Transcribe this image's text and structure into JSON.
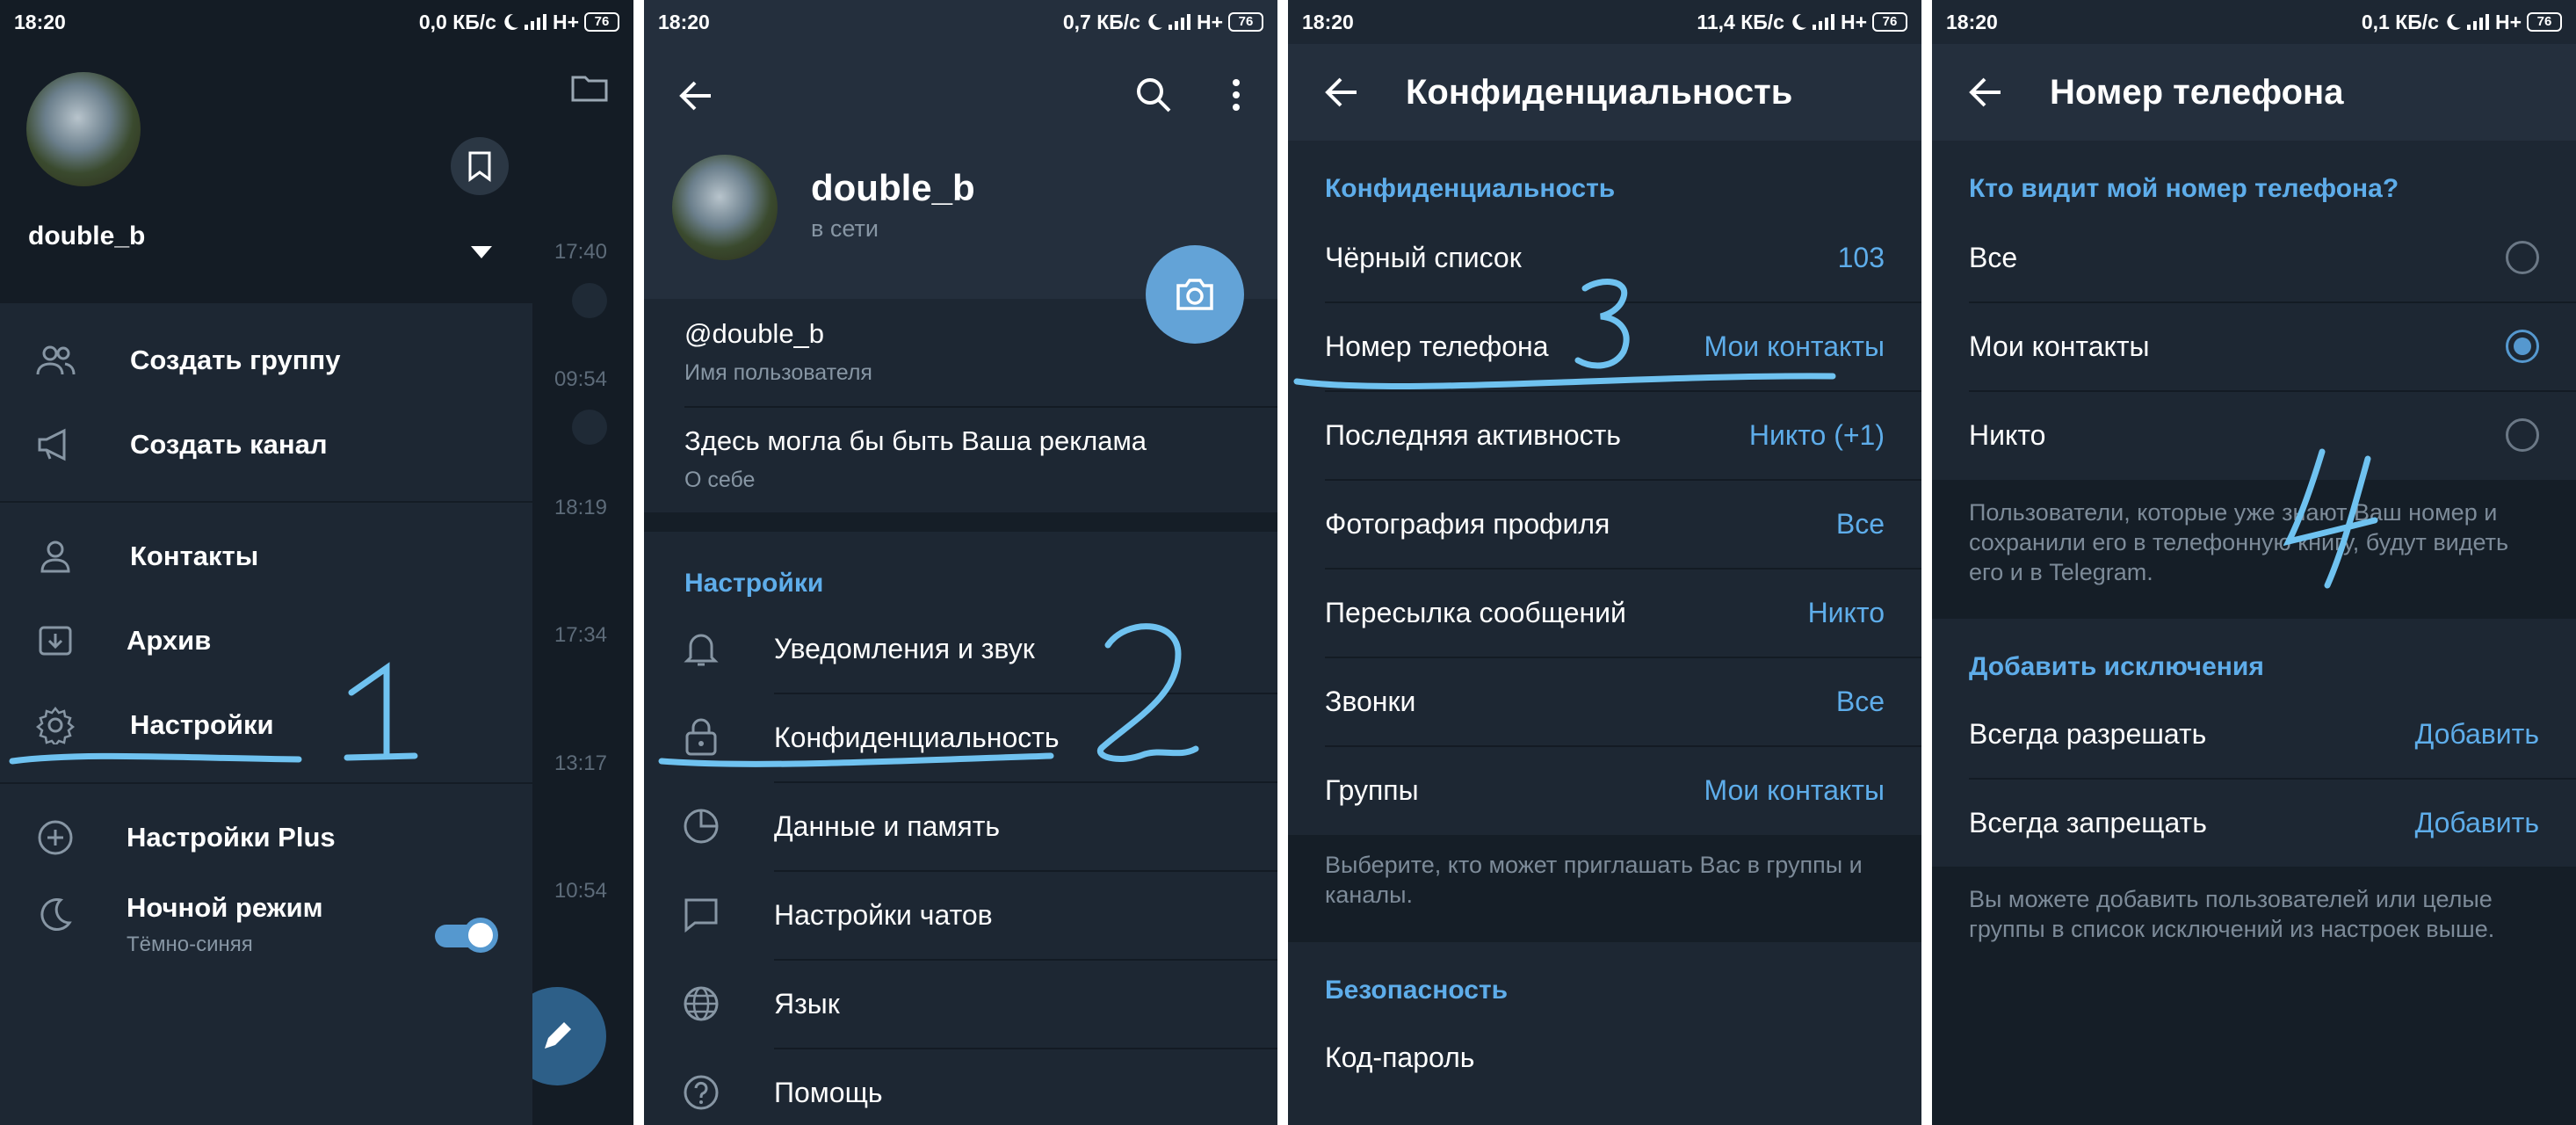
{
  "screens": [
    {
      "status": {
        "time": "18:20",
        "speed": "0,0 КБ/с",
        "network": "H+",
        "battery": "76"
      },
      "drawer": {
        "name": "double_b",
        "menu": [
          {
            "label": "Создать группу",
            "icon": "group-icon"
          },
          {
            "label": "Создать канал",
            "icon": "megaphone-icon"
          },
          {
            "label": "Контакты",
            "icon": "person-icon"
          },
          {
            "label": "Архив",
            "icon": "archive-icon"
          },
          {
            "label": "Настройки",
            "icon": "gear-icon"
          },
          {
            "label": "Настройки Plus",
            "icon": "plus-circle-icon"
          },
          {
            "label": "Ночной режим",
            "sub": "Тёмно-синяя",
            "icon": "moon-icon"
          }
        ],
        "night_mode_enabled": true
      },
      "chat_times": [
        "17:40",
        "09:54",
        "18:19",
        "17:34",
        "13:17",
        "10:54"
      ],
      "annotation": "1"
    },
    {
      "status": {
        "time": "18:20",
        "speed": "0,7 КБ/с",
        "network": "H+",
        "battery": "76"
      },
      "profile": {
        "name": "double_b",
        "status": "в сети"
      },
      "username": {
        "value": "@double_b",
        "label": "Имя пользователя"
      },
      "bio": {
        "value": "Здесь могла бы быть Ваша реклама",
        "label": "О себе"
      },
      "settings_title": "Настройки",
      "settings": [
        {
          "label": "Уведомления и звук",
          "icon": "bell-icon"
        },
        {
          "label": "Конфиденциальность",
          "icon": "lock-icon"
        },
        {
          "label": "Данные и память",
          "icon": "pie-chart-icon"
        },
        {
          "label": "Настройки чатов",
          "icon": "chat-bubble-icon"
        },
        {
          "label": "Язык",
          "icon": "globe-icon"
        },
        {
          "label": "Помощь",
          "icon": "help-icon"
        }
      ],
      "annotation": "2"
    },
    {
      "status": {
        "time": "18:20",
        "speed": "11,4 КБ/с",
        "network": "H+",
        "battery": "76"
      },
      "title": "Конфиденциальность",
      "section1": "Конфиденциальность",
      "rows": [
        {
          "label": "Чёрный список",
          "value": "103"
        },
        {
          "label": "Номер телефона",
          "value": "Мои контакты"
        },
        {
          "label": "Последняя активность",
          "value": "Никто (+1)"
        },
        {
          "label": "Фотография профиля",
          "value": "Все"
        },
        {
          "label": "Пересылка сообщений",
          "value": "Никто"
        },
        {
          "label": "Звонки",
          "value": "Все"
        },
        {
          "label": "Группы",
          "value": "Мои контакты"
        }
      ],
      "groups_hint": "Выберите, кто может приглашать Вас в группы и каналы.",
      "section2": "Безопасность",
      "security_rows": [
        {
          "label": "Код-пароль"
        }
      ],
      "annotation": "3"
    },
    {
      "status": {
        "time": "18:20",
        "speed": "0,1 КБ/с",
        "network": "H+",
        "battery": "76"
      },
      "title": "Номер телефона",
      "question": "Кто видит мой номер телефона?",
      "options": [
        {
          "label": "Все",
          "selected": false
        },
        {
          "label": "Мои контакты",
          "selected": true
        },
        {
          "label": "Никто",
          "selected": false
        }
      ],
      "hint": "Пользователи, которые уже знают Ваш номер и сохранили его в телефонную книгу, будут видеть его и в Telegram.",
      "exceptions_title": "Добавить исключения",
      "exceptions": [
        {
          "label": "Всегда разрешать",
          "value": "Добавить"
        },
        {
          "label": "Всегда запрещать",
          "value": "Добавить"
        }
      ],
      "exceptions_hint": "Вы можете добавить пользователей или целые группы в список исключений из настроек выше.",
      "annotation": "4"
    }
  ],
  "colors": {
    "background": "#1d2733",
    "header": "#242f3d",
    "accent": "#5eadea",
    "annotation": "#6fc2f0"
  }
}
